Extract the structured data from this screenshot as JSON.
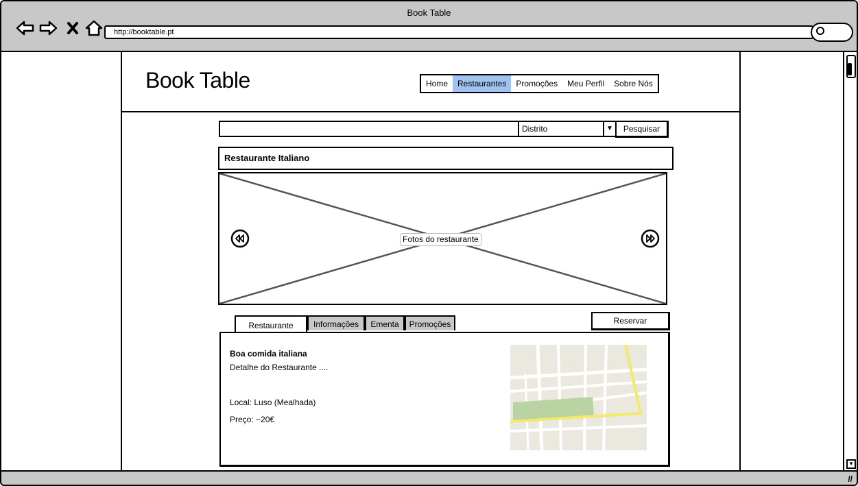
{
  "window": {
    "title": "Book Table"
  },
  "browser": {
    "url": "http://booktable.pt",
    "icons": [
      "back-icon",
      "forward-icon",
      "close-icon",
      "home-icon",
      "search-icon"
    ]
  },
  "site": {
    "logo": "Book Table",
    "nav": [
      {
        "label": "Home",
        "active": false
      },
      {
        "label": "Restaurantes",
        "active": true
      },
      {
        "label": "Promoções",
        "active": false
      },
      {
        "label": "Meu Perfil",
        "active": false
      },
      {
        "label": "Sobre Nós",
        "active": false
      }
    ],
    "accent_color": "#9fc3ee"
  },
  "search": {
    "value": "",
    "district_selected": "Distrito",
    "button_label": "Pesquisar"
  },
  "restaurant": {
    "title": "Restaurante Italiano",
    "photo_label": "Fotos do restaurante",
    "tabs": [
      "Restaurante",
      "Informações",
      "Ementa",
      "Promoções"
    ],
    "active_tab": "Restaurante",
    "reserve_label": "Reservar",
    "panel": {
      "heading": "Boa comida italiana",
      "detail": "Detalhe do Restaurante ....",
      "local": "Local: Luso (Mealhada)",
      "price": "Preço: ~20€"
    }
  }
}
